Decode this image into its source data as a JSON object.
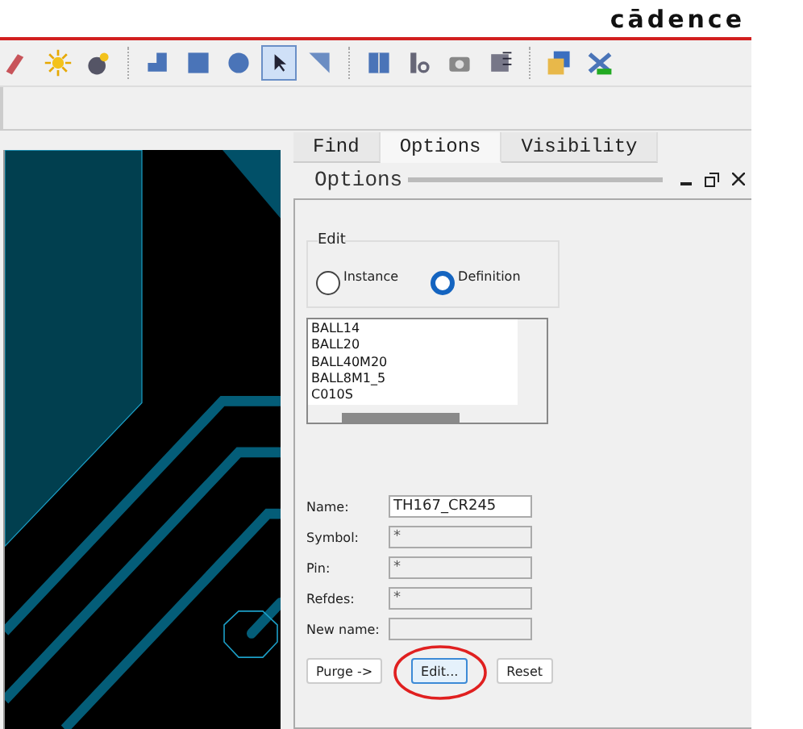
{
  "header": {
    "logo": "cādence"
  },
  "toolbar": [
    {
      "selected": false
    },
    {
      "selected": false
    },
    {
      "selected": false
    },
    {
      "selected": false
    },
    {
      "selected": false
    },
    {
      "selected": false
    },
    {
      "selected": true
    },
    {
      "selected": false
    },
    {
      "selected": false
    },
    {
      "selected": false
    },
    {
      "selected": false
    },
    {
      "selected": false
    },
    {
      "selected": false
    },
    {
      "selected": false
    }
  ],
  "tabs": [
    {
      "label": "Find",
      "selected": false
    },
    {
      "label": "Options",
      "selected": true
    },
    {
      "label": "Visibility",
      "selected": false
    }
  ],
  "panel": {
    "title": "Options",
    "edit_group": {
      "label": "Edit",
      "options": [
        {
          "label": "Instance",
          "selected": false
        },
        {
          "label": "Definition",
          "selected": true
        }
      ]
    },
    "list": [
      "BALL14",
      "BALL20",
      "BALL40M20",
      "BALL8M1_5",
      "C010S"
    ],
    "fields": [
      {
        "label": "Name:",
        "value": "TH167_CR245",
        "disabled": false
      },
      {
        "label": "Symbol:",
        "value": "*",
        "disabled": true
      },
      {
        "label": "Pin:",
        "value": "*",
        "disabled": true
      },
      {
        "label": "Refdes:",
        "value": "*",
        "disabled": true
      },
      {
        "label": "New name:",
        "disabled": true
      }
    ],
    "buttons": [
      {
        "label": "Purge ->",
        "highlighted": false
      },
      {
        "label": "Edit...",
        "highlighted": true
      },
      {
        "label": "Reset",
        "highlighted": false
      }
    ]
  }
}
